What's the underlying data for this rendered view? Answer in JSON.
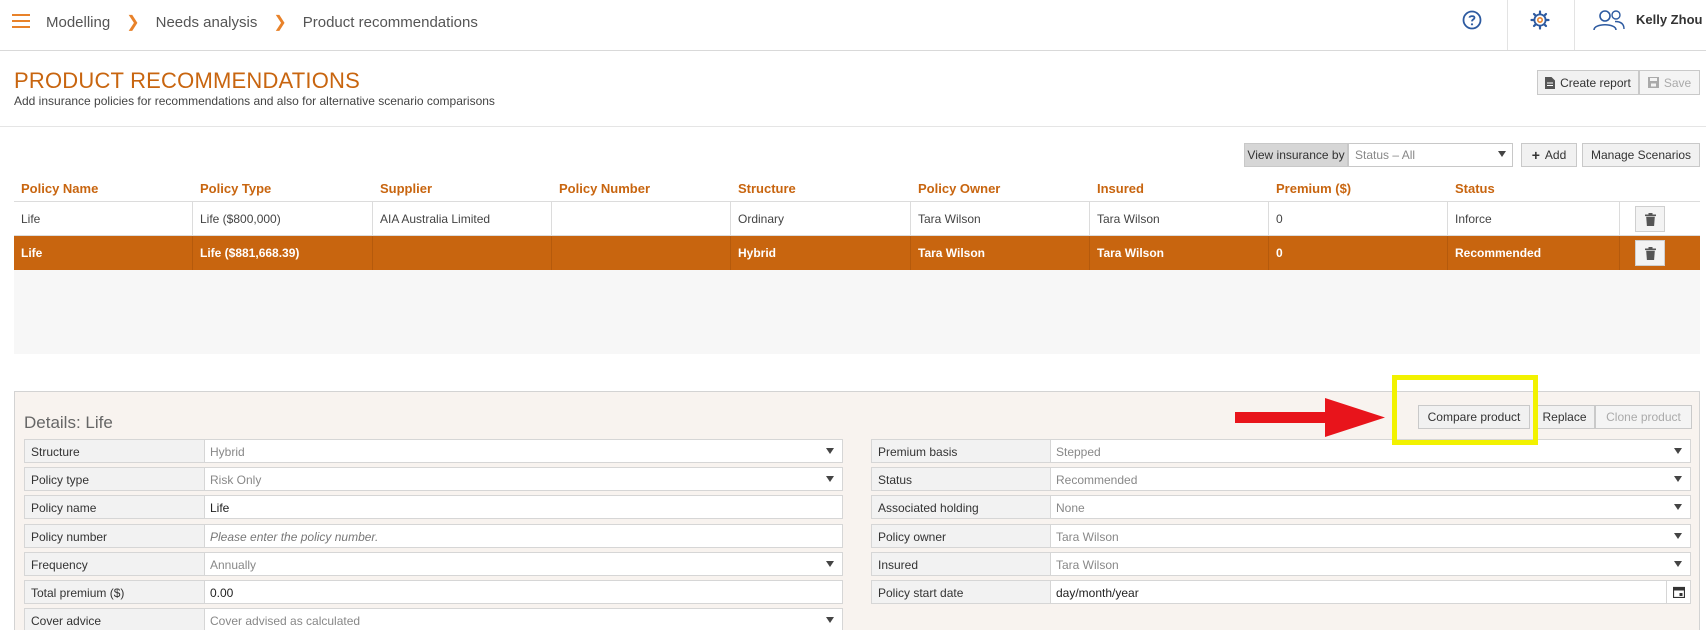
{
  "breadcrumbs": [
    "Modelling",
    "Needs analysis",
    "Product recommendations"
  ],
  "user": {
    "name": "Kelly Zhou"
  },
  "header": {
    "title": "PRODUCT RECOMMENDATIONS",
    "subtitle": "Add insurance policies for recommendations and also for alternative scenario comparisons",
    "create_report_label": "Create report",
    "save_label": "Save"
  },
  "view": {
    "label": "View insurance by",
    "selected": "Status – All",
    "add_label": "Add",
    "manage_label": "Manage Scenarios"
  },
  "table": {
    "columns": [
      "Policy Name",
      "Policy Type",
      "Supplier",
      "Policy Number",
      "Structure",
      "Policy Owner",
      "Insured",
      "Premium ($)",
      "Status"
    ],
    "rows": [
      [
        "Life",
        "Life ($800,000)",
        "AIA Australia Limited",
        "",
        "Ordinary",
        "Tara Wilson",
        "Tara Wilson",
        "0",
        "Inforce"
      ],
      [
        "Life",
        "Life ($881,668.39)",
        "",
        "",
        "Hybrid",
        "Tara Wilson",
        "Tara Wilson",
        "0",
        "Recommended"
      ]
    ]
  },
  "details": {
    "title": "Details: Life",
    "compare_label": "Compare product",
    "replace_label": "Replace",
    "clone_label": "Clone product",
    "left_fields": [
      {
        "label": "Structure",
        "value": "Hybrid"
      },
      {
        "label": "Policy type",
        "value": "Risk Only"
      },
      {
        "label": "Policy name",
        "value": "Life"
      },
      {
        "label": "Policy number",
        "value": "Please enter the policy number."
      },
      {
        "label": "Frequency",
        "value": "Annually"
      },
      {
        "label": "Total premium ($)",
        "value": "0.00"
      },
      {
        "label": "Cover advice",
        "value": "Cover advised as calculated"
      }
    ],
    "right_fields": [
      {
        "label": "Premium basis",
        "value": "Stepped"
      },
      {
        "label": "Status",
        "value": "Recommended"
      },
      {
        "label": "Associated holding",
        "value": "None"
      },
      {
        "label": "Policy owner",
        "value": "Tara Wilson"
      },
      {
        "label": "Insured",
        "value": "Tara Wilson"
      },
      {
        "label": "Policy start date",
        "value": "day/month/year"
      }
    ]
  },
  "colors": {
    "accent": "#c8650f",
    "icon_orange": "#e8822a",
    "icon_blue": "#2d5aa0",
    "highlight": "#f2f200",
    "arrow": "#e8141b"
  }
}
